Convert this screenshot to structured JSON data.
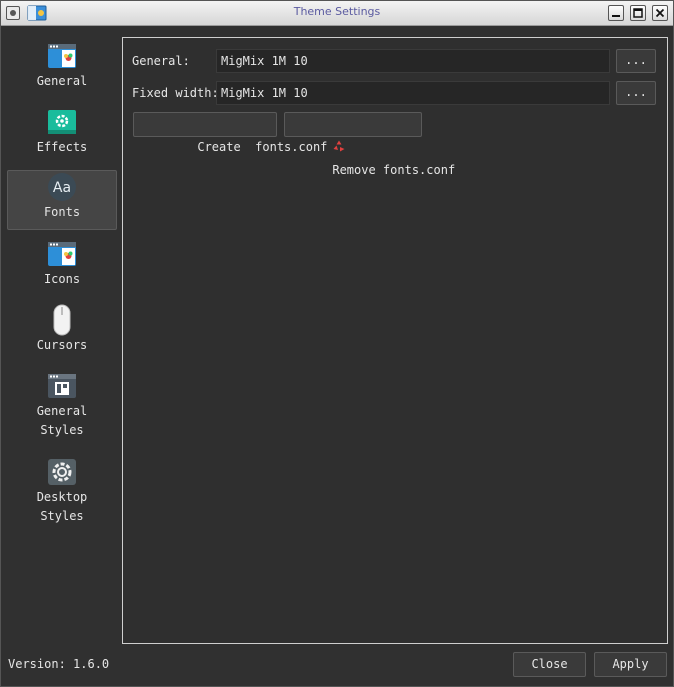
{
  "window": {
    "title": "Theme Settings",
    "app_icon": "theme-settings-app-icon",
    "controls": {
      "menu_icon": "window-menu-icon",
      "minimize_icon": "minimize-icon",
      "maximize_icon": "maximize-icon",
      "close_icon": "close-icon"
    }
  },
  "sidebar": {
    "items": [
      {
        "label": "General",
        "icon": "window-general-icon"
      },
      {
        "label": "Effects",
        "icon": "gear-effects-icon"
      },
      {
        "label": "Fonts",
        "icon": "fonts-aa-icon",
        "selected": true
      },
      {
        "label": "Icons",
        "icon": "window-icons-icon"
      },
      {
        "label": "Cursors",
        "icon": "mouse-cursor-icon"
      },
      {
        "label": "General\nStyles",
        "icon": "window-layout-icon"
      },
      {
        "label": "Desktop\nStyles",
        "icon": "gear-desktop-icon"
      }
    ]
  },
  "fonts": {
    "general_label": "General:",
    "general_value": "MigMix 1M 10",
    "fixed_label": "Fixed width:",
    "fixed_value": "MigMix 1M 10",
    "browse_label": "...",
    "create_label": "Create  fonts.conf",
    "remove_label": "Remove fonts.conf",
    "remove_icon": "recycle-remove-icon"
  },
  "footer": {
    "version": "Version: 1.6.0",
    "close_label": "Close",
    "apply_label": "Apply"
  },
  "colors": {
    "background": "#303030",
    "field_background": "#262626",
    "accent_teal": "#1abc9c",
    "accent_blue": "#2d8fd8",
    "remove_red": "#e0413f"
  }
}
